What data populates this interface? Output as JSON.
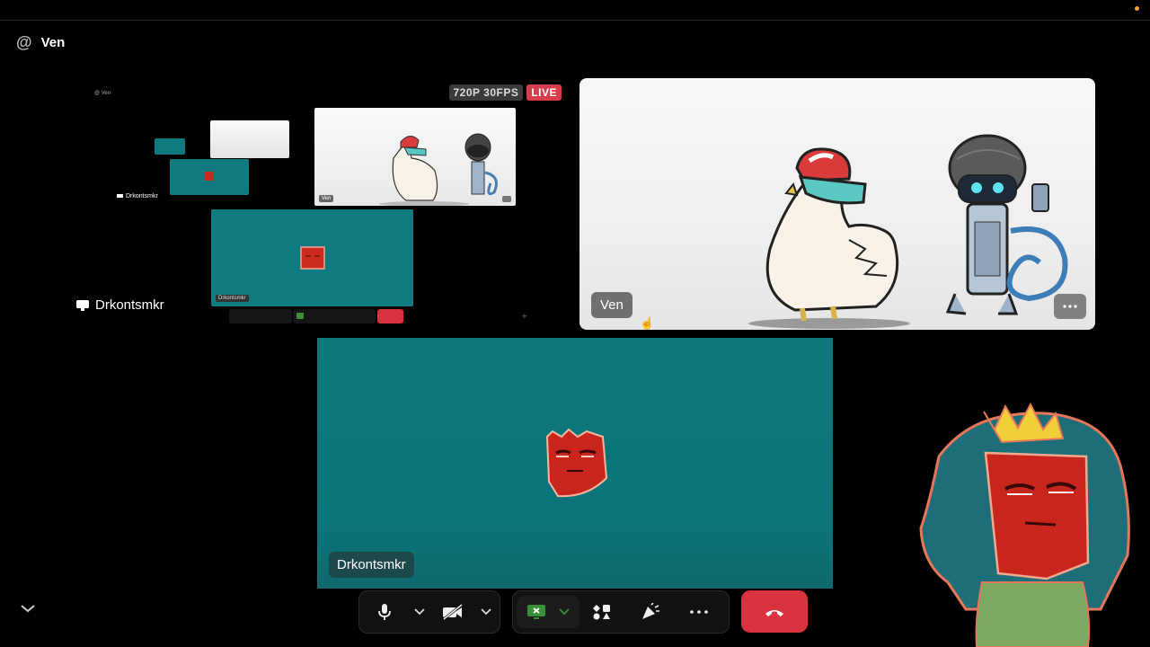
{
  "header": {
    "channel_icon": "at-icon",
    "channel_name": "Ven"
  },
  "stream": {
    "resolution_badge": "720P 30FPS",
    "live_badge": "LIVE",
    "streamer_name": "Drkontsmkr",
    "nested_header": "Ven",
    "nested_name_tag": "Drkontsmkr",
    "nested_cam_tag": "Ven"
  },
  "camera_tile": {
    "name": "Ven"
  },
  "main_tile": {
    "name": "Drkontsmkr"
  },
  "colors": {
    "live": "#d83c4a",
    "teal": "#0f7a80",
    "hangup": "#d8333f",
    "screenshare_active": "#3a8f3a"
  },
  "controls": {
    "icons": [
      "microphone-icon",
      "chevron-down-icon",
      "camera-off-icon",
      "chevron-down-icon",
      "screenshare-icon",
      "chevron-down-icon",
      "activities-icon",
      "soundboard-icon",
      "more-icon",
      "hangup-icon"
    ]
  }
}
